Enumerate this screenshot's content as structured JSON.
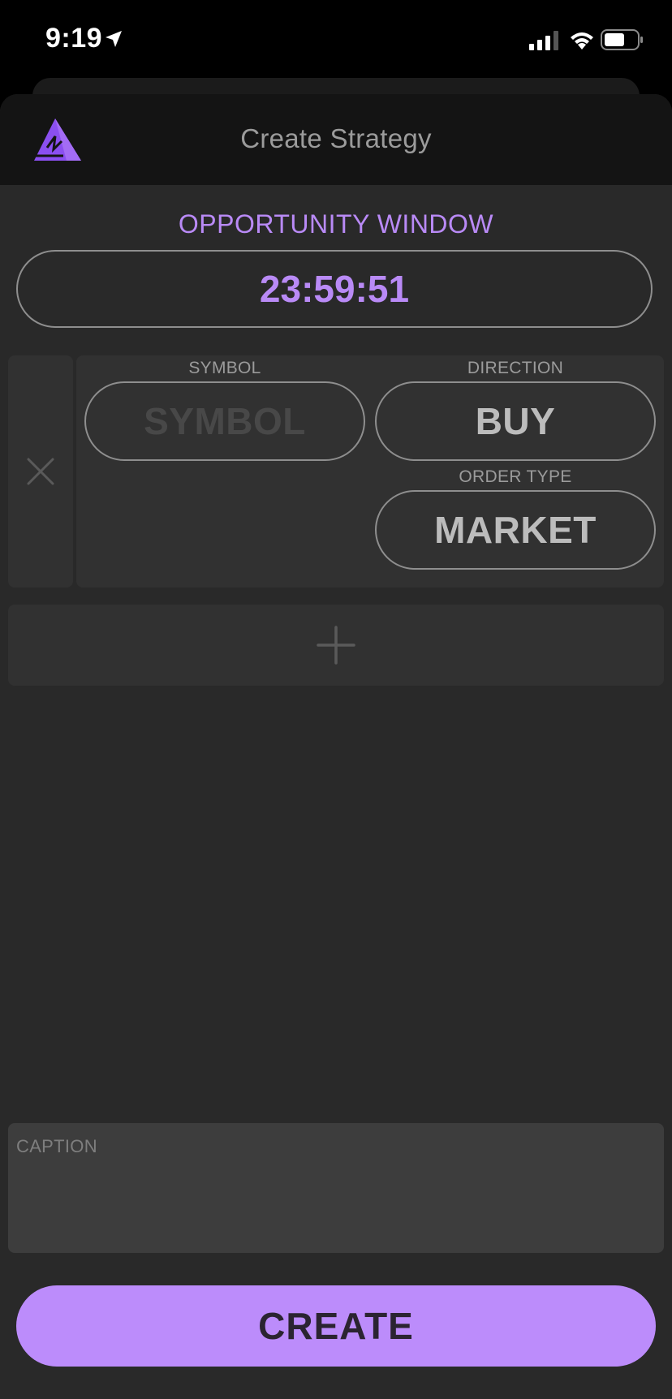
{
  "status_bar": {
    "time": "9:19",
    "icons": [
      "location-arrow-icon",
      "signal-icon",
      "wifi-icon",
      "battery-icon"
    ]
  },
  "header": {
    "title": "Create Strategy",
    "logo_icon": "mountain-logo-icon"
  },
  "opportunity": {
    "label": "OPPORTUNITY WINDOW",
    "timer": "23:59:51"
  },
  "leg": {
    "remove_icon": "close-icon",
    "symbol_label": "SYMBOL",
    "symbol_placeholder": "SYMBOL",
    "direction_label": "DIRECTION",
    "direction_value": "BUY",
    "order_type_label": "ORDER TYPE",
    "order_type_value": "MARKET"
  },
  "add_leg": {
    "icon": "plus-icon"
  },
  "caption": {
    "placeholder": "CAPTION"
  },
  "create_button": {
    "label": "CREATE"
  },
  "colors": {
    "accent": "#bc8cfb",
    "accent_text": "#b98af6",
    "background": "#292929",
    "header_bg": "#141414",
    "card_bg": "#313131",
    "caption_bg": "#3d3d3d"
  }
}
